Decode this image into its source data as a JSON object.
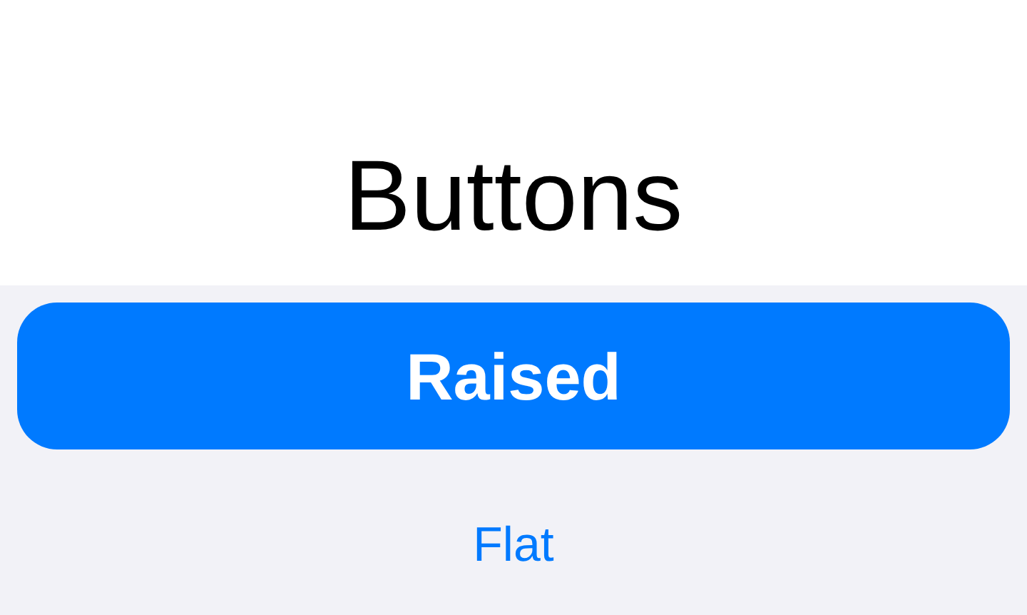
{
  "title": "Buttons",
  "buttons": [
    {
      "label": "Raised",
      "kind": "raised"
    },
    {
      "label": "Flat",
      "kind": "flat"
    }
  ]
}
